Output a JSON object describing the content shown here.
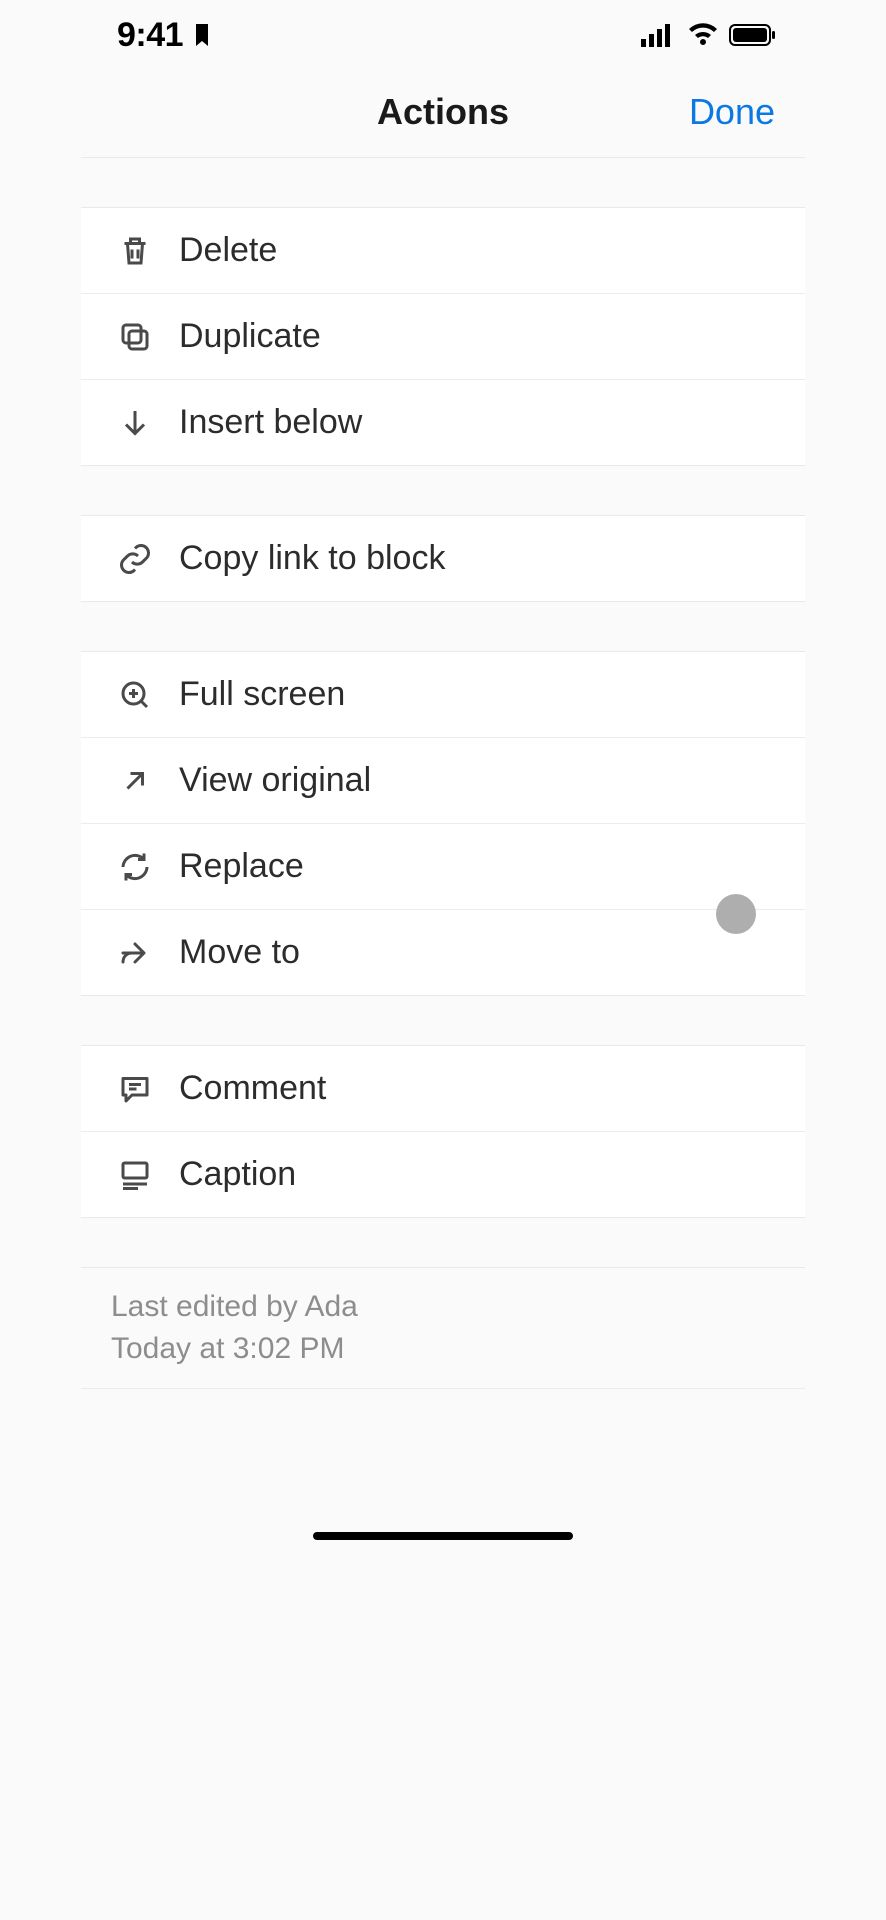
{
  "status": {
    "time": "9:41"
  },
  "header": {
    "title": "Actions",
    "done_label": "Done"
  },
  "groups": [
    {
      "items": [
        {
          "id": "delete",
          "label": "Delete",
          "icon": "trash-icon"
        },
        {
          "id": "duplicate",
          "label": "Duplicate",
          "icon": "duplicate-icon"
        },
        {
          "id": "insert-below",
          "label": "Insert below",
          "icon": "arrow-down-icon"
        }
      ]
    },
    {
      "items": [
        {
          "id": "copy-link",
          "label": "Copy link to block",
          "icon": "link-icon"
        }
      ]
    },
    {
      "items": [
        {
          "id": "full-screen",
          "label": "Full screen",
          "icon": "zoom-in-icon"
        },
        {
          "id": "view-original",
          "label": "View original",
          "icon": "open-external-icon"
        },
        {
          "id": "replace",
          "label": "Replace",
          "icon": "refresh-icon"
        },
        {
          "id": "move-to",
          "label": "Move to",
          "icon": "move-to-icon"
        }
      ]
    },
    {
      "items": [
        {
          "id": "comment",
          "label": "Comment",
          "icon": "comment-icon"
        },
        {
          "id": "caption",
          "label": "Caption",
          "icon": "caption-icon"
        }
      ]
    }
  ],
  "footer": {
    "edited_by": "Last edited by Ada",
    "timestamp": "Today at 3:02 PM"
  }
}
